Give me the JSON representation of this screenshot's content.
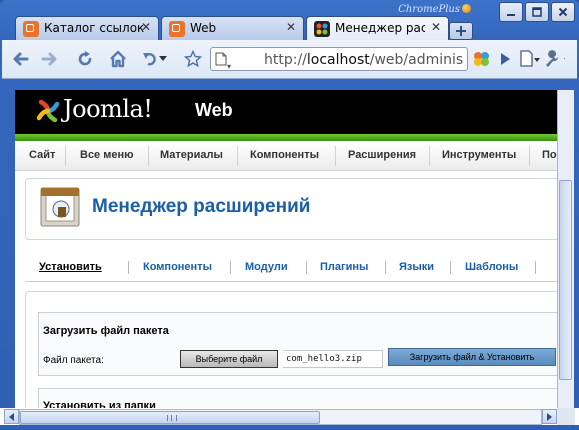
{
  "window": {
    "brand": "ChromePlus",
    "controls": [
      "minimize",
      "maximize",
      "close"
    ]
  },
  "tabs": [
    {
      "label": "Каталог ссылок",
      "icon": "joomla-icon",
      "active": false
    },
    {
      "label": "Web",
      "icon": "joomla-icon",
      "active": false
    },
    {
      "label": "Менеджер рас",
      "icon": "joomla-black-icon",
      "active": true
    }
  ],
  "toolbar": {
    "url_scheme": "http://",
    "url_host": "localhost",
    "url_path": "/web/adminis"
  },
  "joomla": {
    "logo_text": "Joomla!",
    "site_name": "Web",
    "menu": [
      "Сайт",
      "Все меню",
      "Материалы",
      "Компоненты",
      "Расширения",
      "Инструменты",
      "По"
    ]
  },
  "page": {
    "title": "Менеджер расширений",
    "subnav": [
      {
        "label": "Установить",
        "active": true
      },
      {
        "label": "Компоненты",
        "active": false
      },
      {
        "label": "Модули",
        "active": false
      },
      {
        "label": "Плагины",
        "active": false
      },
      {
        "label": "Языки",
        "active": false
      },
      {
        "label": "Шаблоны",
        "active": false
      }
    ],
    "upload": {
      "heading": "Загрузить файл пакета",
      "file_label": "Файл пакета:",
      "choose_button": "Выберите файл",
      "file_name": "com_hello3.zip",
      "submit_button": "Загрузить файл & Установить"
    },
    "folder_heading": "Установить из папки"
  },
  "colors": {
    "accent_blue": "#1a5fa8",
    "joomla_green": "#5bb320",
    "header_black": "#000000",
    "frame_blue": "#3467bd"
  }
}
